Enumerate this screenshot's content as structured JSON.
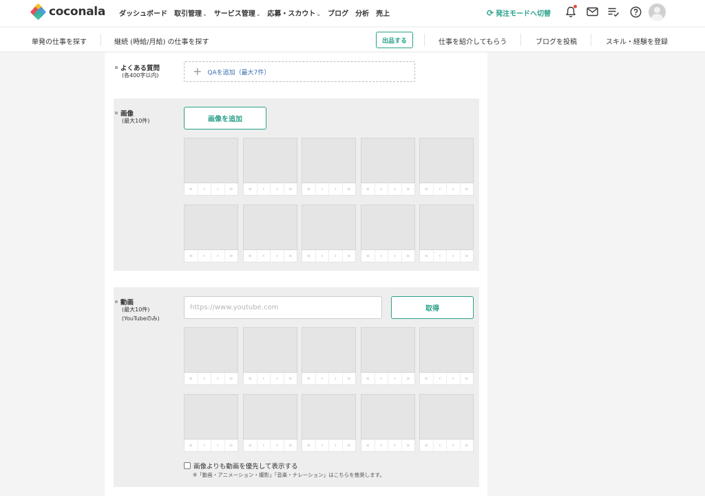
{
  "header": {
    "logo_text": "coconala",
    "nav": [
      {
        "label": "ダッシュボード",
        "has_dropdown": false
      },
      {
        "label": "取引管理",
        "has_dropdown": true
      },
      {
        "label": "サービス管理",
        "has_dropdown": true
      },
      {
        "label": "応募・スカウト",
        "has_dropdown": true
      },
      {
        "label": "ブログ",
        "has_dropdown": false
      },
      {
        "label": "分析",
        "has_dropdown": false
      },
      {
        "label": "売上",
        "has_dropdown": false
      }
    ],
    "mode_switch_label": "発注モードへ切替",
    "icons": [
      "bell-icon",
      "mail-icon",
      "task-list-icon",
      "help-icon"
    ],
    "notification_dot_color": "#e74c3c"
  },
  "subnav": {
    "single_job": "単発の仕事を探す",
    "continuous_job": "継続 (時給/月給) の仕事を探す",
    "post_button": "出品する",
    "introduce_job": "仕事を紹介してもらう",
    "post_blog": "ブログを投稿",
    "register_skill": "スキル・経験を登録"
  },
  "faq": {
    "label": "よくある質問",
    "note": "(各400字以内)",
    "add_label": "QAを追加（最大7件）"
  },
  "images": {
    "label": "画像",
    "note": "(最大10件)",
    "add_button": "画像を追加",
    "slot_count": 10
  },
  "videos": {
    "label": "動画",
    "note_line1": "(最大10件)",
    "note_line2": "(YouTubeのみ)",
    "url_placeholder": "https://www.youtube.com",
    "url_value": "",
    "fetch_button": "取得",
    "slot_count": 10,
    "prefer_video_label": "画像よりも動画を優先して表示する",
    "prefer_video_checked": false,
    "prefer_video_note": "※「動画・アニメーション・撮影」「音楽・ナレーション」はこちらを推奨します。"
  },
  "slot_controls": [
    "«",
    "‹",
    "›",
    "»"
  ],
  "colors": {
    "accent": "#29a089",
    "link": "#3a6fb0",
    "logo": [
      "#f5c02b",
      "#e94b5c",
      "#3d8fe0",
      "#34b89a"
    ]
  }
}
